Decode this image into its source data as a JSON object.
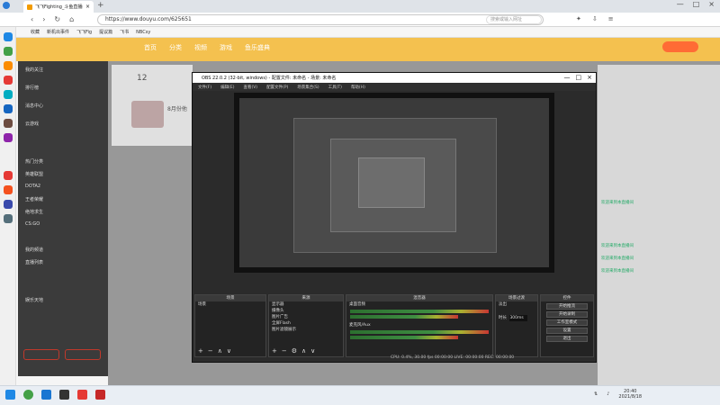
{
  "browser": {
    "tab_title": "飞飞Fighting_斗鱼直播间",
    "url": "https://www.douyu.com/625651",
    "search_placeholder": "搜索或输入网址",
    "bookmarks": [
      "收藏",
      "新机出事件",
      "飞飞Fig",
      "提议篇",
      "飞书",
      "NBCsy"
    ]
  },
  "douyu": {
    "nav": [
      "首页",
      "分类",
      "视频",
      "游戏",
      "鱼乐盛典"
    ],
    "follow_count": "12",
    "room_note": "8月份他"
  },
  "sidebar": {
    "items": [
      "我的关注",
      "排行榜",
      "消息中心",
      "云游戏",
      "热门分类",
      "英雄联盟",
      "DOTA2",
      "王者荣耀",
      "绝地求生",
      "CS:GO",
      "我的频道",
      "直播列表",
      "娱乐天地"
    ]
  },
  "obs": {
    "title": "OBS 22.0.2 (32-bit, windows) - 配置文件: 未命名 - 场景: 未命名",
    "menu": [
      "文件(F)",
      "编辑(E)",
      "查看(V)",
      "配置文件(P)",
      "场景集合(S)",
      "工具(T)",
      "帮助(H)"
    ],
    "docks": {
      "scenes": {
        "title": "场景",
        "items": [
          "场景"
        ]
      },
      "sources": {
        "title": "来源",
        "items": [
          "显示器",
          "摄像头",
          "图片广告",
          "全屏Flash",
          "图片滤镜展示"
        ]
      },
      "mixer": {
        "title": "混音器",
        "tracks": [
          "桌面音频",
          "麦克风/Aux"
        ]
      },
      "transitions": {
        "title": "场景过渡",
        "mode": "淡出",
        "duration_label": "时长",
        "duration": "300ms"
      },
      "controls": {
        "title": "控件",
        "buttons": [
          "开始推流",
          "开始录制",
          "工作室模式",
          "设置",
          "退出"
        ]
      }
    },
    "status": "CPU: 0.4%, 30.00 fps    00:00:00    LIVE: 00:00:00    REC: 00:00:00"
  },
  "chat_lines": [
    "欢迎来到本直播间",
    "欢迎来到本直播间",
    "欢迎来到本直播间",
    "欢迎来到本直播间"
  ],
  "taskbar": {
    "clock_time": "20:40",
    "clock_date": "2021/8/18"
  }
}
